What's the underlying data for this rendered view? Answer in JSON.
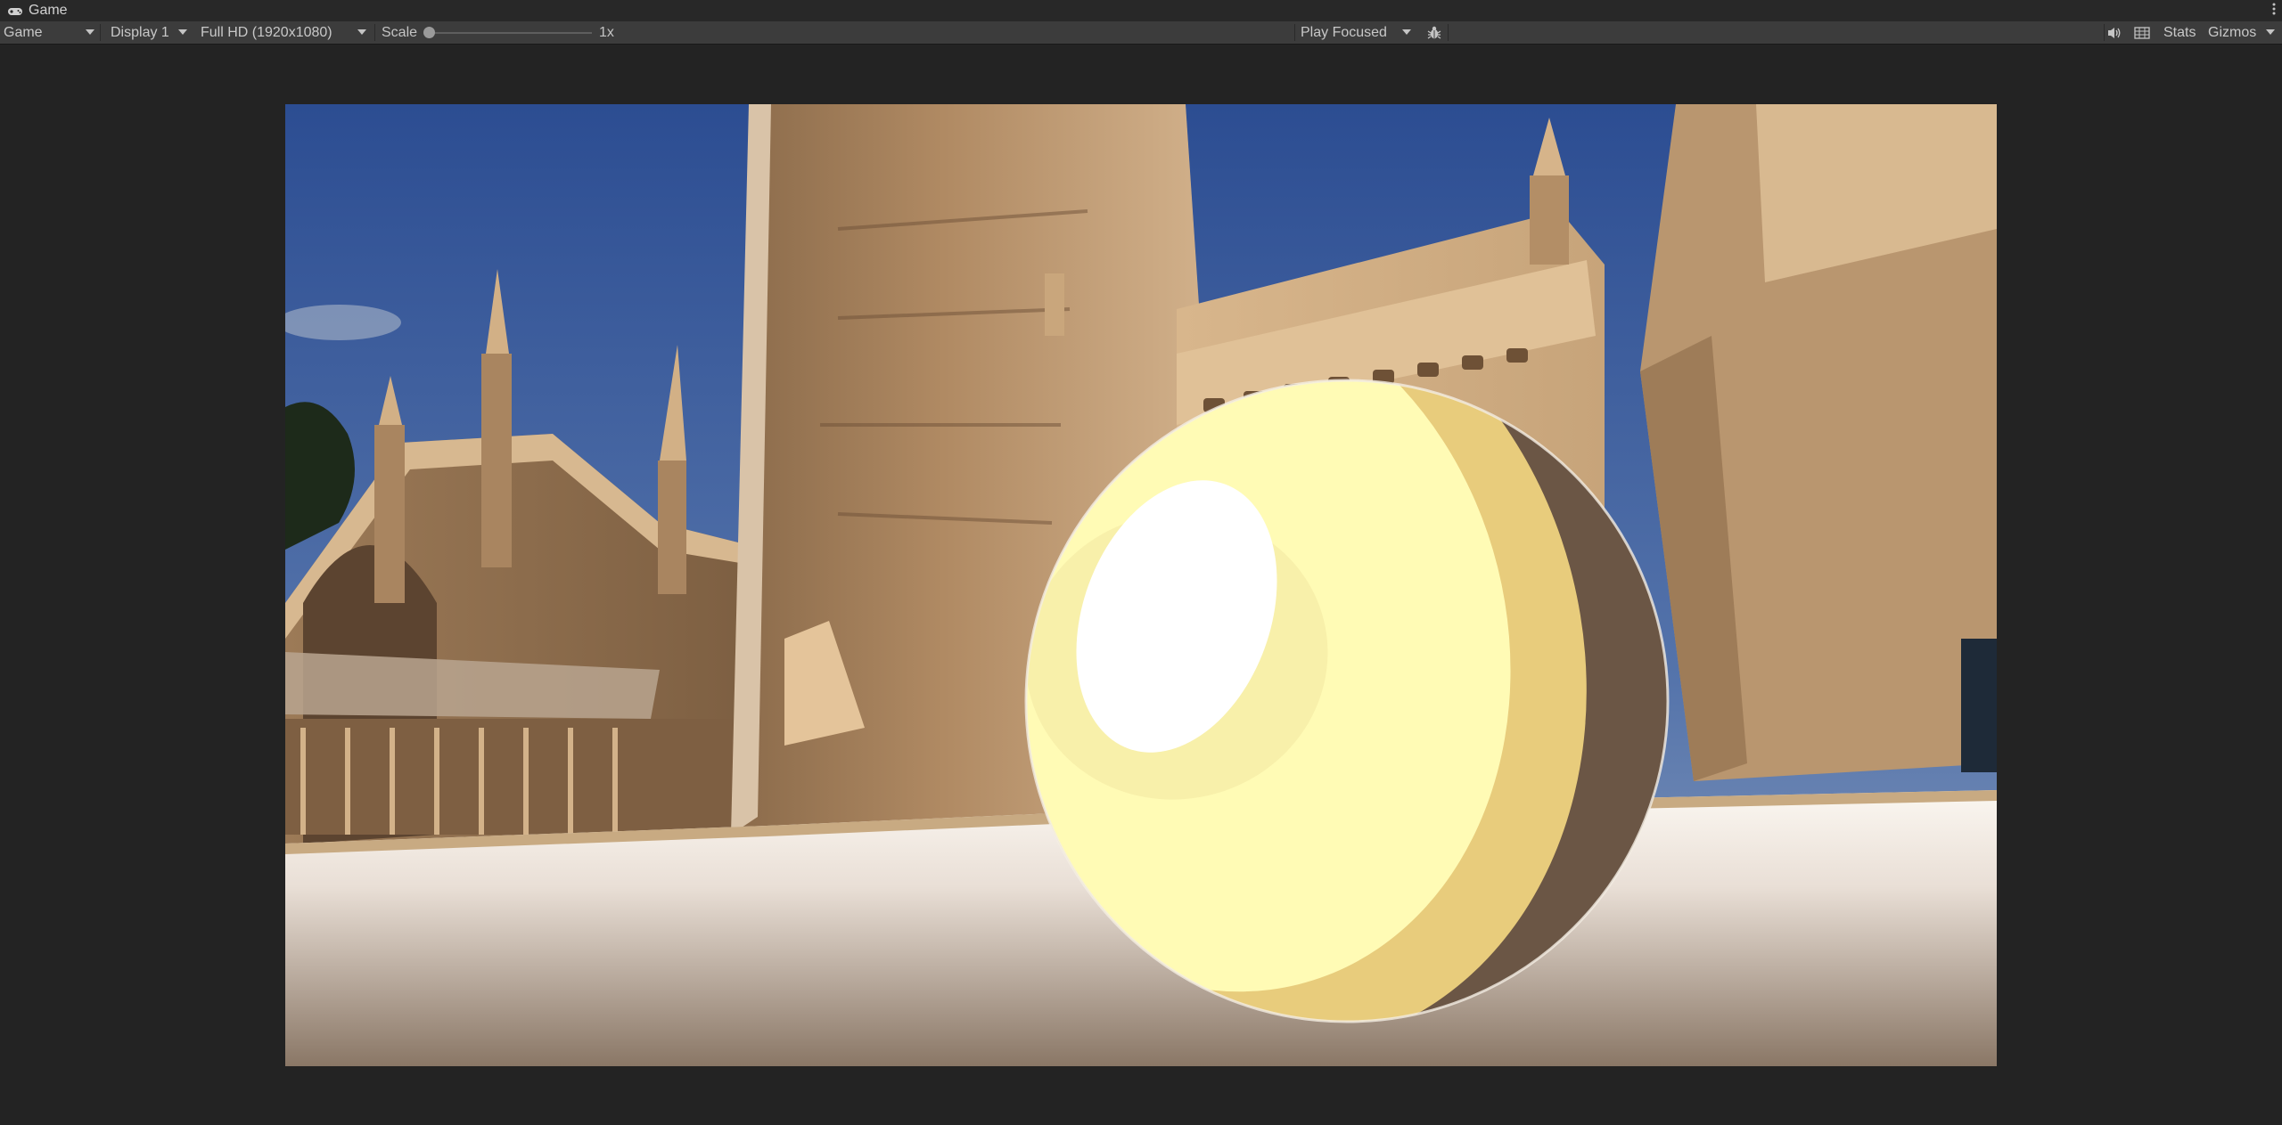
{
  "window": {
    "tab_title": "Game",
    "tab_icon": "gamepad-icon",
    "menu_icon": "kebab-menu-icon"
  },
  "toolbar": {
    "view_mode": "Game",
    "display": "Display 1",
    "resolution": "Full HD (1920x1080)",
    "scale_label": "Scale",
    "scale_value": "1x",
    "scale_level": 0,
    "play_mode": "Play Focused",
    "debug_icon": "bug-icon",
    "audio_icon": "speaker-icon",
    "grid_icon": "keyboard-grid-icon",
    "stats_label": "Stats",
    "gizmos_label": "Gizmos"
  },
  "colors": {
    "background": "#232323",
    "toolbar": "#3c3c3c",
    "sky": "#4a6aa3",
    "stone": "#c9a77c",
    "sphere_light": "#fffbb5",
    "sphere_dark": "#6b5645"
  }
}
